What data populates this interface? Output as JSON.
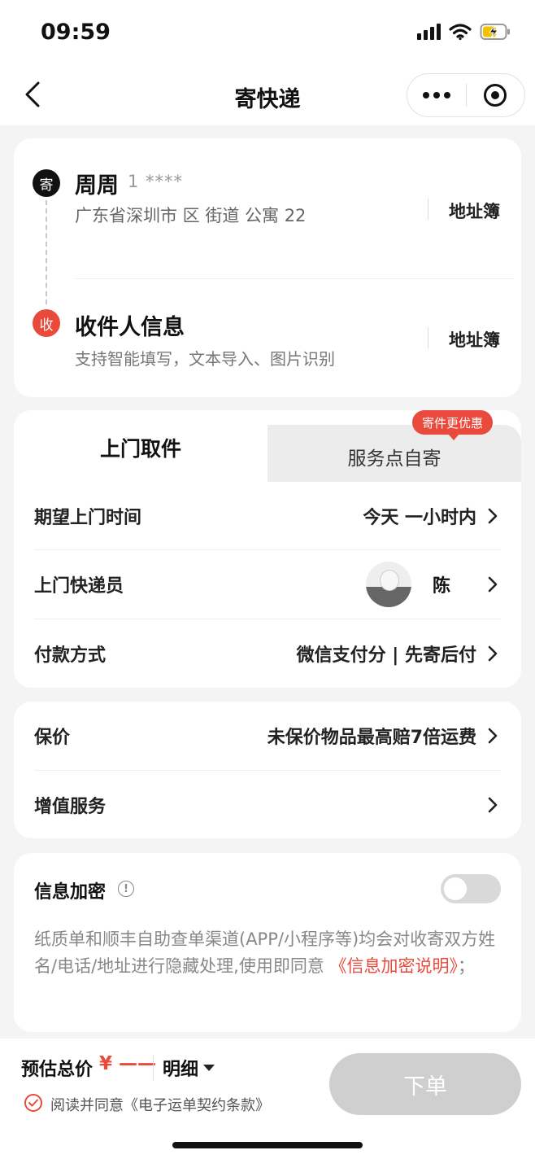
{
  "status_bar": {
    "time": "09:59"
  },
  "nav": {
    "title": "寄快递"
  },
  "sender": {
    "badge": "寄",
    "name": "周周",
    "phone": "1 ****",
    "address": "广东省深圳市      区      街道         公寓      22",
    "address_book": "地址簿"
  },
  "receiver": {
    "badge": "收",
    "title": "收件人信息",
    "hint": "支持智能填写，文本导入、图片识别",
    "address_book": "地址簿"
  },
  "tabs": {
    "pickup": "上门取件",
    "self_drop": "服务点自寄",
    "promo": "寄件更优惠"
  },
  "service_rows": {
    "time_label": "期望上门时间",
    "time_value": "今天  一小时内",
    "courier_label": "上门快递员",
    "courier_name": "陈",
    "payment_label": "付款方式",
    "payment_value": "微信支付分 | 先寄后付"
  },
  "insurance": {
    "label": "保价",
    "value": "未保价物品最高赔7倍运费",
    "addon_label": "增值服务"
  },
  "encryption": {
    "title": "信息加密",
    "info": "!",
    "desc": "纸质单和顺丰自助查单渠道(APP/小程序等)均会对收寄双方姓名/电话/地址进行隐藏处理,使用即同意 ",
    "link": "《信息加密说明》",
    "tail": "；",
    "enabled": false
  },
  "bottom": {
    "price_label": "预估总价",
    "price_value": "¥ ——",
    "detail": "明细",
    "agree_text": "阅读并同意《电子运单契约条款》",
    "order_button": "下单"
  }
}
